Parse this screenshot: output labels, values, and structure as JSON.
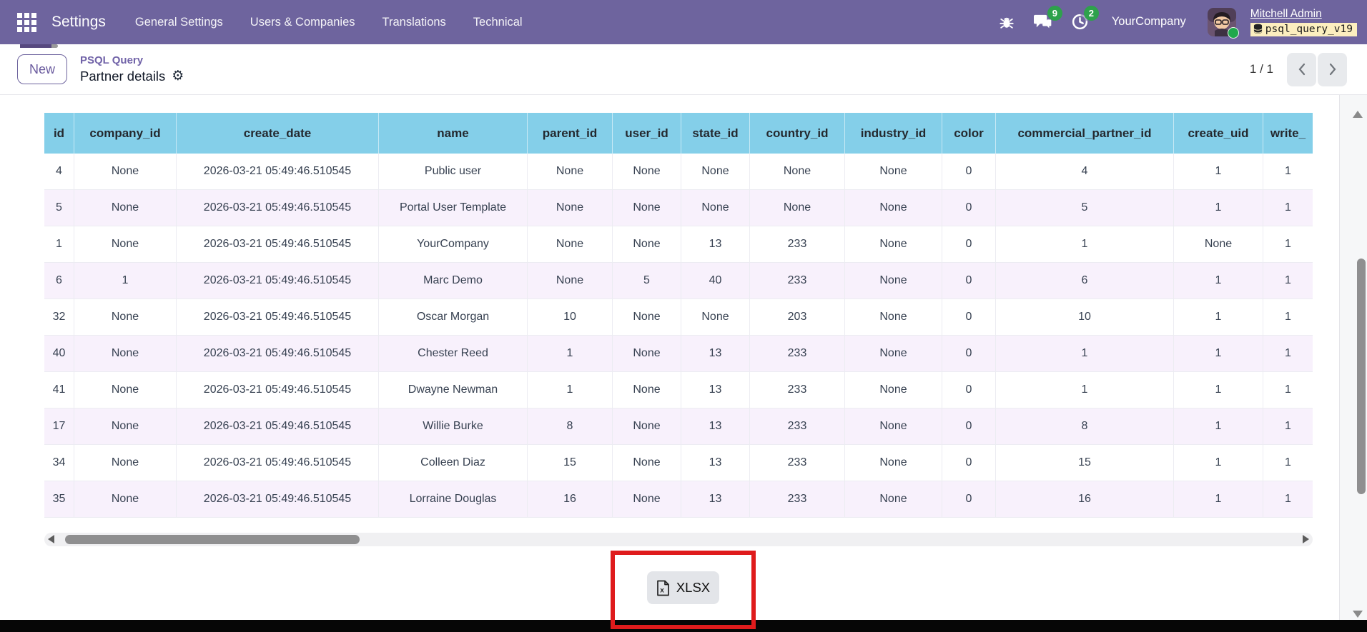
{
  "nav": {
    "app_name": "Settings",
    "items": [
      {
        "label": "General Settings"
      },
      {
        "label": "Users & Companies"
      },
      {
        "label": "Translations"
      },
      {
        "label": "Technical"
      }
    ],
    "messages_count": "9",
    "activities_count": "2",
    "company": "YourCompany",
    "user_name": "Mitchell Admin",
    "database_badge": "psql_query_v19"
  },
  "control_panel": {
    "new_button": "New",
    "breadcrumb_parent": "PSQL Query",
    "breadcrumb_current": "Partner details",
    "gear_glyph": "⚙",
    "pager": "1 / 1"
  },
  "table": {
    "headers": [
      "id",
      "company_id",
      "create_date",
      "name",
      "parent_id",
      "user_id",
      "state_id",
      "country_id",
      "industry_id",
      "color",
      "commercial_partner_id",
      "create_uid",
      "write_"
    ],
    "rows": [
      [
        "4",
        "None",
        "2026-03-21 05:49:46.510545",
        "Public user",
        "None",
        "None",
        "None",
        "None",
        "None",
        "0",
        "4",
        "1",
        "1"
      ],
      [
        "5",
        "None",
        "2026-03-21 05:49:46.510545",
        "Portal User Template",
        "None",
        "None",
        "None",
        "None",
        "None",
        "0",
        "5",
        "1",
        "1"
      ],
      [
        "1",
        "None",
        "2026-03-21 05:49:46.510545",
        "YourCompany",
        "None",
        "None",
        "13",
        "233",
        "None",
        "0",
        "1",
        "None",
        "1"
      ],
      [
        "6",
        "1",
        "2026-03-21 05:49:46.510545",
        "Marc Demo",
        "None",
        "5",
        "40",
        "233",
        "None",
        "0",
        "6",
        "1",
        "1"
      ],
      [
        "32",
        "None",
        "2026-03-21 05:49:46.510545",
        "Oscar Morgan",
        "10",
        "None",
        "None",
        "203",
        "None",
        "0",
        "10",
        "1",
        "1"
      ],
      [
        "40",
        "None",
        "2026-03-21 05:49:46.510545",
        "Chester Reed",
        "1",
        "None",
        "13",
        "233",
        "None",
        "0",
        "1",
        "1",
        "1"
      ],
      [
        "41",
        "None",
        "2026-03-21 05:49:46.510545",
        "Dwayne Newman",
        "1",
        "None",
        "13",
        "233",
        "None",
        "0",
        "1",
        "1",
        "1"
      ],
      [
        "17",
        "None",
        "2026-03-21 05:49:46.510545",
        "Willie Burke",
        "8",
        "None",
        "13",
        "233",
        "None",
        "0",
        "8",
        "1",
        "1"
      ],
      [
        "34",
        "None",
        "2026-03-21 05:49:46.510545",
        "Colleen Diaz",
        "15",
        "None",
        "13",
        "233",
        "None",
        "0",
        "15",
        "1",
        "1"
      ],
      [
        "35",
        "None",
        "2026-03-21 05:49:46.510545",
        "Lorraine Douglas",
        "16",
        "None",
        "13",
        "233",
        "None",
        "0",
        "16",
        "1",
        "1"
      ]
    ]
  },
  "footer": {
    "xlsx_button": "XLSX"
  },
  "icons": {
    "apps": "grid-icon",
    "debug": "bug-icon",
    "messages": "chat-bubbles-icon",
    "activities": "clock-icon",
    "database": "database-icon",
    "settings_action": "gear-icon",
    "pager_prev": "chevron-left-icon",
    "pager_next": "chevron-right-icon",
    "export": "excel-file-icon"
  },
  "colors": {
    "navbar": "#6e649e",
    "table_header": "#84cfe9",
    "row_alternate": "#f8f1fc",
    "count_badge": "#2ea14c",
    "presence": "#1fa84c",
    "database_badge_bg": "#fcefbf",
    "accent_link": "#7163a8",
    "annotation_red": "#df1b1c"
  }
}
